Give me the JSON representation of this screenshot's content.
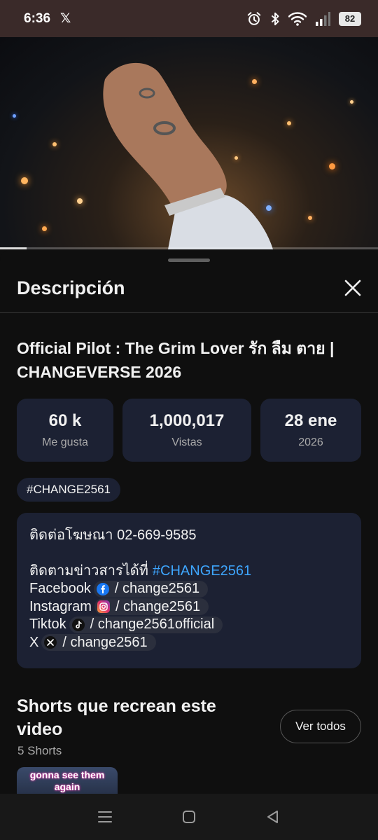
{
  "status_bar": {
    "time": "6:36",
    "x_glyph": "𝕏",
    "battery": "82",
    "icons": [
      "x-logo-icon",
      "alarm-icon",
      "bluetooth-icon",
      "wifi-icon",
      "signal-icon",
      "battery-icon"
    ]
  },
  "video": {
    "progress": 0.07
  },
  "sheet": {
    "title": "Descripción",
    "close_icon": "close-icon"
  },
  "video_title": "Official Pilot : The Grim Lover รัก ลืม ตาย | CHANGEVERSE 2026",
  "stats": [
    {
      "value": "60 k",
      "label": "Me gusta"
    },
    {
      "value": "1,000,017",
      "label": "Vistas"
    },
    {
      "value": "28 ene",
      "label": "2026"
    }
  ],
  "hashtag_chip": "#CHANGE2561",
  "description": {
    "line1": "ติดต่อโฆษณา 02-669-9585",
    "line2_text": "ติดตามข่าวสารได้ที่",
    "line2_link": "#CHANGE2561",
    "socials": [
      {
        "platform": "Facebook",
        "icon": "facebook-icon",
        "handle": "/ change2561",
        "color": "#1877f2"
      },
      {
        "platform": "Instagram",
        "icon": "instagram-icon",
        "handle": "/ change2561",
        "color": "#e1306c"
      },
      {
        "platform": "Tiktok",
        "icon": "tiktok-icon",
        "handle": "/ change2561official",
        "color": "#111111"
      },
      {
        "platform": "X",
        "icon": "x-icon",
        "handle": "/ change2561",
        "color": "#111111"
      }
    ]
  },
  "shorts": {
    "title": "Shorts que recrean este video",
    "count": "5 Shorts",
    "see_all": "Ver todos",
    "thumb_caption": "gonna see them again"
  },
  "nav_bar": {
    "icons": [
      "recents-icon",
      "home-icon",
      "back-icon"
    ]
  },
  "colors": {
    "background": "#0f0f0f",
    "card": "#1c2133",
    "link": "#3ea6ff",
    "status_bar": "#3a2a29"
  }
}
